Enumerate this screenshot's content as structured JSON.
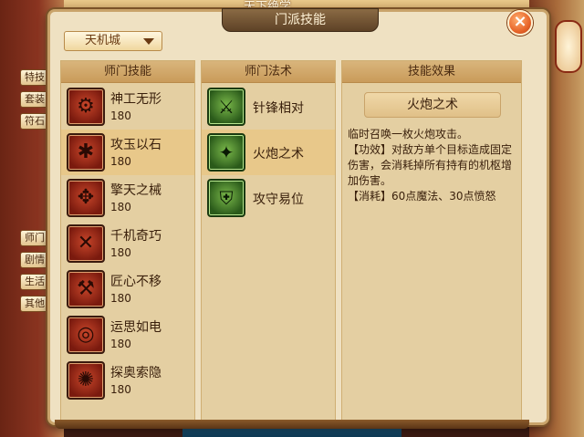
{
  "header": {
    "game_title": "天下绝学",
    "panel_title": "门派技能"
  },
  "background": {
    "lantern_text": "",
    "upper_tabs": [
      "特技",
      "套装",
      "符石"
    ],
    "lower_tabs": [
      "师门",
      "剧情",
      "生活",
      "其他"
    ]
  },
  "dropdown": {
    "selected": "天机城"
  },
  "columns": {
    "skills_header": "师门技能",
    "spells_header": "师门法术",
    "effect_header": "技能效果"
  },
  "skills": [
    {
      "name": "神工无形",
      "level": "180",
      "icon": "wrench-spiral-icon"
    },
    {
      "name": "攻玉以石",
      "level": "180",
      "icon": "gear-mask-icon"
    },
    {
      "name": "擎天之械",
      "level": "180",
      "icon": "windmill-icon"
    },
    {
      "name": "千机奇巧",
      "level": "180",
      "icon": "crossed-tools-icon"
    },
    {
      "name": "匠心不移",
      "level": "180",
      "icon": "hammer-icon"
    },
    {
      "name": "运思如电",
      "level": "180",
      "icon": "swirl-icon"
    },
    {
      "name": "探奥索隐",
      "level": "180",
      "icon": "vortex-icon"
    }
  ],
  "selected_skill_index": 1,
  "spells": [
    {
      "name": "针锋相对",
      "icon": "crossed-swords-icon"
    },
    {
      "name": "火炮之术",
      "icon": "cannon-creature-icon"
    },
    {
      "name": "攻守易位",
      "icon": "shield-swap-icon"
    }
  ],
  "selected_spell_index": 1,
  "effect": {
    "title": "火炮之术",
    "line1": "临时召唤一枚火炮攻击。",
    "line2": "【功效】对敌方单个目标造成固定伤害，会消耗掉所有持有的机枢增加伤害。",
    "line3": "【消耗】60点魔法、30点愤怒"
  },
  "colors": {
    "accent": "#c9a36a",
    "selected_row": "#e8c88a",
    "close_button": "#e8662a"
  }
}
